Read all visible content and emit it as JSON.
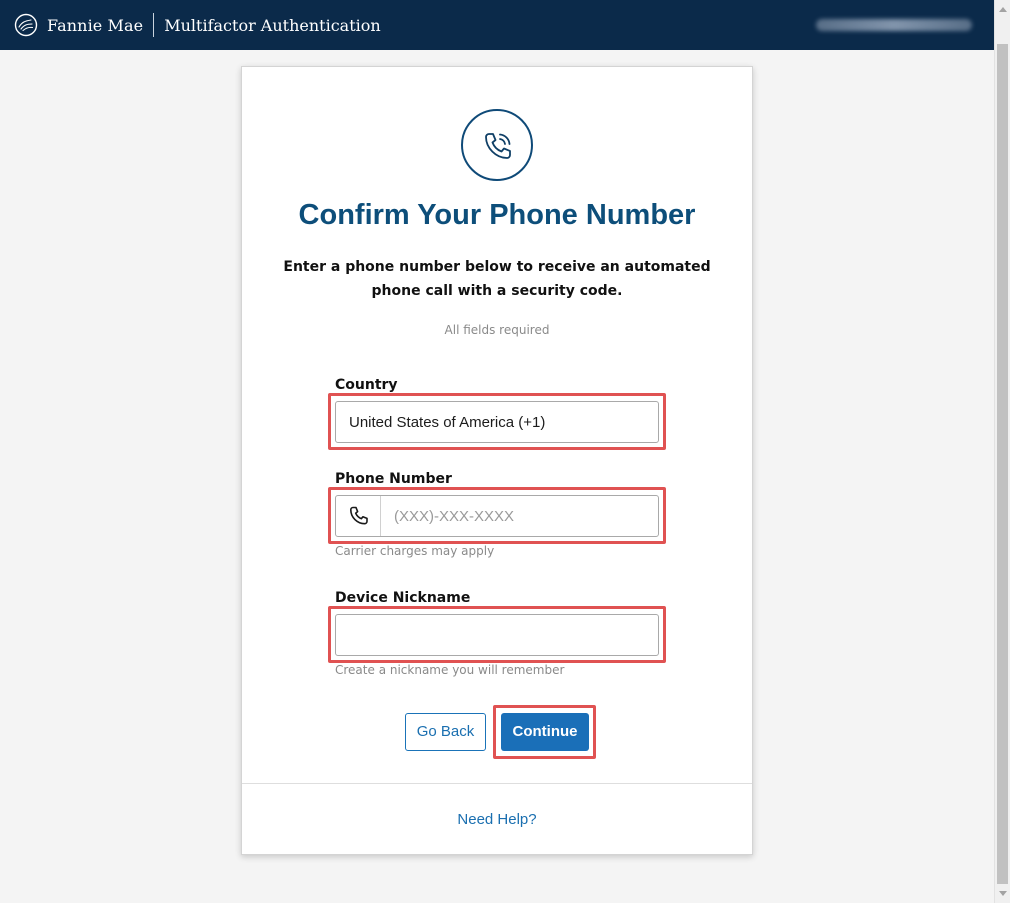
{
  "header": {
    "brand_name": "Fannie Mae",
    "app_title": "Multifactor Authentication",
    "user_label": "User name (blurred)"
  },
  "card": {
    "icon": "phone-call-icon",
    "title": "Confirm Your Phone Number",
    "intro": "Enter a phone number below to receive an automated phone call with a security code.",
    "required_note": "All fields required",
    "country": {
      "label": "Country",
      "value": "United States of America (+1)"
    },
    "phone": {
      "label": "Phone Number",
      "placeholder": "(XXX)-XXX-XXXX",
      "hint": "Carrier charges may apply",
      "icon": "phone-icon"
    },
    "nickname": {
      "label": "Device Nickname",
      "value": "",
      "hint": "Create a nickname you will remember"
    },
    "buttons": {
      "back": "Go Back",
      "continue": "Continue"
    },
    "help_link": "Need Help?"
  },
  "colors": {
    "header_bg": "#0b2a4a",
    "title": "#0d4e7a",
    "primary_button": "#1a6fb8",
    "link": "#1a6fb0",
    "highlight": "#e05252"
  }
}
